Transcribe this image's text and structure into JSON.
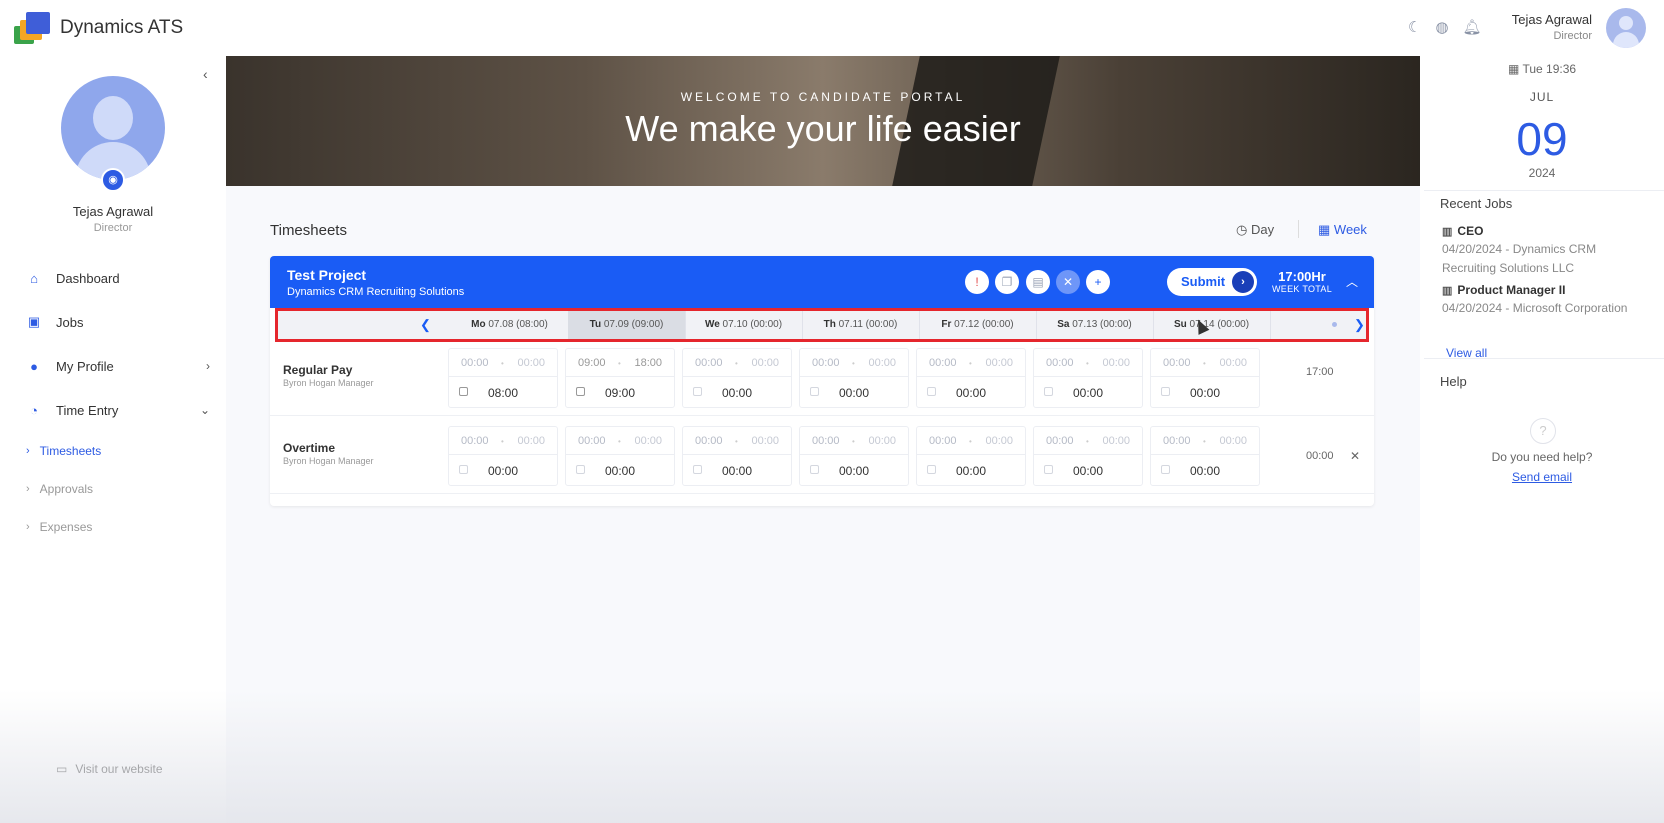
{
  "app": {
    "title": "Dynamics ATS"
  },
  "header": {
    "icons": [
      "moon-icon",
      "globe-icon",
      "bell-icon"
    ],
    "user_name": "Tejas Agrawal",
    "user_role": "Director"
  },
  "sidebar": {
    "user_name": "Tejas Agrawal",
    "user_role": "Director",
    "items": [
      {
        "label": "Dashboard",
        "icon": "home-icon"
      },
      {
        "label": "Jobs",
        "icon": "briefcase-icon"
      },
      {
        "label": "My Profile",
        "icon": "user-icon"
      },
      {
        "label": "Time Entry",
        "icon": "clock-icon"
      }
    ],
    "sub_items": [
      {
        "label": "Timesheets",
        "active": true
      },
      {
        "label": "Approvals",
        "active": false
      },
      {
        "label": "Expenses",
        "active": false
      }
    ],
    "footer_link": "Visit our website"
  },
  "hero": {
    "subtitle": "WELCOME TO CANDIDATE PORTAL",
    "title": "We make your life easier"
  },
  "timesheets": {
    "title": "Timesheets",
    "view_day": "Day",
    "view_week": "Week",
    "project": {
      "name": "Test Project",
      "client": "Dynamics CRM Recruiting Solutions",
      "submit_label": "Submit",
      "week_total_value": "17:00Hr",
      "week_total_label": "WEEK TOTAL"
    },
    "days": [
      {
        "abbr": "Mo",
        "date": "07.08 (08:00)",
        "active": false
      },
      {
        "abbr": "Tu",
        "date": "07.09 (09:00)",
        "active": true
      },
      {
        "abbr": "We",
        "date": "07.10 (00:00)",
        "active": false
      },
      {
        "abbr": "Th",
        "date": "07.11 (00:00)",
        "active": false
      },
      {
        "abbr": "Fr",
        "date": "07.12 (00:00)",
        "active": false
      },
      {
        "abbr": "Sa",
        "date": "07.13 (00:00)",
        "active": false
      },
      {
        "abbr": "Su",
        "date": "07.14 (00:00)",
        "active": false
      }
    ],
    "rows": [
      {
        "name": "Regular Pay",
        "sub": "Byron Hogan Manager",
        "total": "17:00",
        "cells": [
          {
            "start": "00:00",
            "end": "00:00",
            "total": "08:00"
          },
          {
            "start": "09:00",
            "end": "18:00",
            "total": "09:00"
          },
          {
            "start": "00:00",
            "end": "00:00",
            "total": "00:00"
          },
          {
            "start": "00:00",
            "end": "00:00",
            "total": "00:00"
          },
          {
            "start": "00:00",
            "end": "00:00",
            "total": "00:00"
          },
          {
            "start": "00:00",
            "end": "00:00",
            "total": "00:00"
          },
          {
            "start": "00:00",
            "end": "00:00",
            "total": "00:00"
          }
        ]
      },
      {
        "name": "Overtime",
        "sub": "Byron Hogan Manager",
        "total": "00:00",
        "cells": [
          {
            "start": "00:00",
            "end": "00:00",
            "total": "00:00"
          },
          {
            "start": "00:00",
            "end": "00:00",
            "total": "00:00"
          },
          {
            "start": "00:00",
            "end": "00:00",
            "total": "00:00"
          },
          {
            "start": "00:00",
            "end": "00:00",
            "total": "00:00"
          },
          {
            "start": "00:00",
            "end": "00:00",
            "total": "00:00"
          },
          {
            "start": "00:00",
            "end": "00:00",
            "total": "00:00"
          },
          {
            "start": "00:00",
            "end": "00:00",
            "total": "00:00"
          }
        ]
      }
    ]
  },
  "right_panel": {
    "datetime": "Tue 19:36",
    "month": "JUL",
    "day": "09",
    "year": "2024",
    "recent_jobs_title": "Recent Jobs",
    "jobs": [
      {
        "title": "CEO",
        "detail": "04/20/2024 - Dynamics CRM Recruiting Solutions LLC"
      },
      {
        "title": "Product Manager II",
        "detail": "04/20/2024 - Microsoft Corporation"
      }
    ],
    "view_all": "View all",
    "help_title": "Help",
    "help_text": "Do you need help?",
    "send_email": "Send email"
  },
  "colors": {
    "primary": "#1a5cf5",
    "highlight": "#e5262d"
  }
}
